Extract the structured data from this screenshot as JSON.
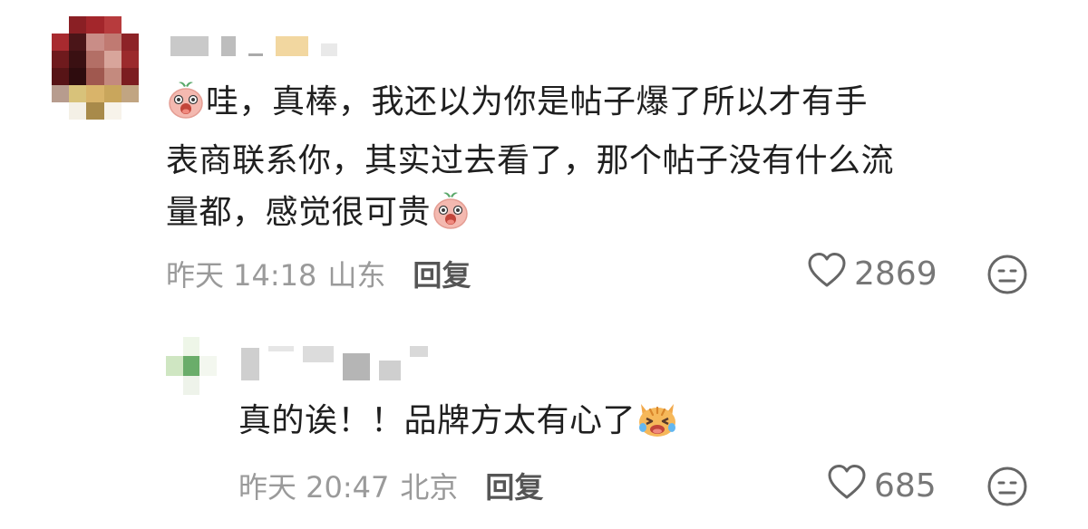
{
  "comments": [
    {
      "text_lines": [
        "哇，真棒，我还以为你是帖子爆了所以才有手",
        "表商联系你，其实过去看了，那个帖子没有什么流",
        "量都，感觉很可贵"
      ],
      "emoji_icon": "onion-face-icon",
      "time": "昨天 14:18",
      "location": "山东",
      "reply_label": "回复",
      "likes": "2869"
    }
  ],
  "replies": [
    {
      "text": "真的诶！！品牌方太有心了",
      "emoji_icon": "crying-cat-icon",
      "time": "昨天 20:47",
      "location": "北京",
      "reply_label": "回复",
      "likes": "685"
    }
  ],
  "icons": {
    "like": "heart-outline-icon",
    "dislike": "neutral-face-icon"
  },
  "colors": {
    "meta_gray": "#9a9a9a",
    "text": "#1f1f1f",
    "reply_label": "#555555"
  }
}
